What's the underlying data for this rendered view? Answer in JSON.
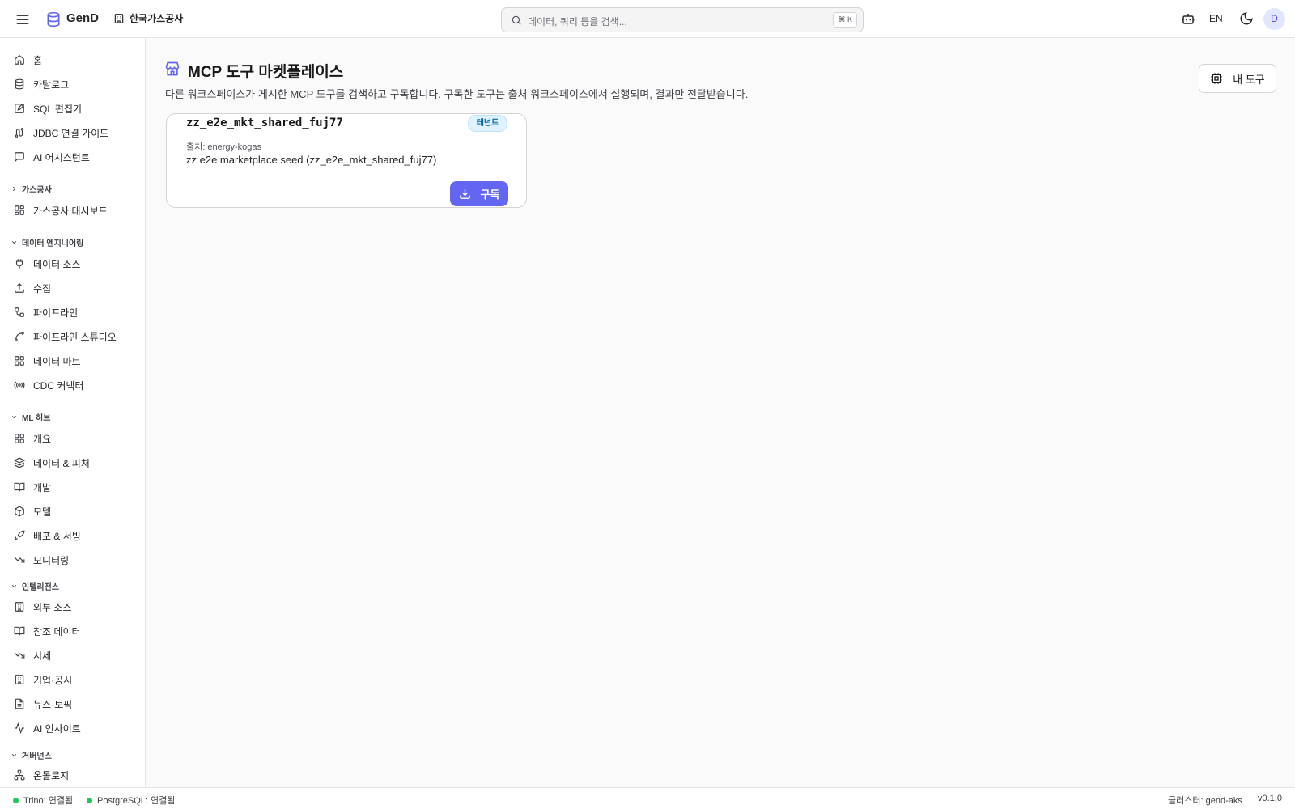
{
  "app": {
    "brand": "GenD",
    "org_name": "한국가스공사",
    "lang": "EN",
    "avatar_initial": "D",
    "accent": "#6366f1"
  },
  "search": {
    "placeholder": "데이터, 쿼리 등을 검색...",
    "shortcut": "⌘ K"
  },
  "sidebar": {
    "top_items": [
      {
        "label": "홈",
        "icon": "home-icon"
      },
      {
        "label": "카탈로그",
        "icon": "database-icon"
      },
      {
        "label": "SQL 편집기",
        "icon": "edit-icon"
      },
      {
        "label": "JDBC 연결 가이드",
        "icon": "route-icon"
      },
      {
        "label": "AI 어시스턴트",
        "icon": "chat-icon"
      }
    ],
    "sections": [
      {
        "label": "가스공사",
        "expanded": false,
        "items": [
          {
            "label": "가스공사 대시보드",
            "icon": "dashboard-icon"
          }
        ]
      },
      {
        "label": "데이터 엔지니어링",
        "expanded": true,
        "items": [
          {
            "label": "데이터 소스",
            "icon": "plug-icon"
          },
          {
            "label": "수집",
            "icon": "upload-icon"
          },
          {
            "label": "파이프라인",
            "icon": "workflow-icon"
          },
          {
            "label": "파이프라인 스튜디오",
            "icon": "spline-icon"
          },
          {
            "label": "데이터 마트",
            "icon": "grid-icon"
          },
          {
            "label": "CDC 커넥터",
            "icon": "radio-icon"
          }
        ]
      },
      {
        "label": "ML 허브",
        "expanded": true,
        "items": [
          {
            "label": "개요",
            "icon": "grid-icon"
          },
          {
            "label": "데이터 & 피처",
            "icon": "layers-icon"
          },
          {
            "label": "개발",
            "icon": "book-icon"
          },
          {
            "label": "모델",
            "icon": "box-icon"
          },
          {
            "label": "배포 & 서빙",
            "icon": "rocket-icon"
          },
          {
            "label": "모니터링",
            "icon": "trending-down-icon"
          }
        ]
      },
      {
        "label": "인텔리전스",
        "expanded": true,
        "items": [
          {
            "label": "외부 소스",
            "icon": "building-icon"
          },
          {
            "label": "참조 데이터",
            "icon": "book-icon"
          },
          {
            "label": "시세",
            "icon": "trending-down-icon"
          },
          {
            "label": "기업·공시",
            "icon": "building-icon"
          },
          {
            "label": "뉴스·토픽",
            "icon": "file-icon"
          },
          {
            "label": "AI 인사이트",
            "icon": "activity-icon"
          }
        ]
      },
      {
        "label": "거버넌스",
        "expanded": true,
        "items": [
          {
            "label": "온톨로지",
            "icon": "network-icon"
          }
        ]
      }
    ]
  },
  "main": {
    "title": "MCP 도구 마켓플레이스",
    "subtitle": "다른 워크스페이스가 게시한 MCP 도구를 검색하고 구독합니다. 구독한 도구는 출처 워크스페이스에서 실행되며, 결과만 전달받습니다.",
    "my_tools_label": "내 도구",
    "cards": [
      {
        "name": "zz_e2e_mkt_shared_fuj77",
        "badge": "테넌트",
        "origin": "출처: energy-kogas",
        "description": "zz e2e marketplace seed (zz_e2e_mkt_shared_fuj77)",
        "subscribe_label": "구독"
      }
    ]
  },
  "status": {
    "trino": "Trino: 연결됨",
    "postgres": "PostgreSQL: 연결됨",
    "cluster": "클러스터: gend-aks",
    "version": "v0.1.0"
  }
}
